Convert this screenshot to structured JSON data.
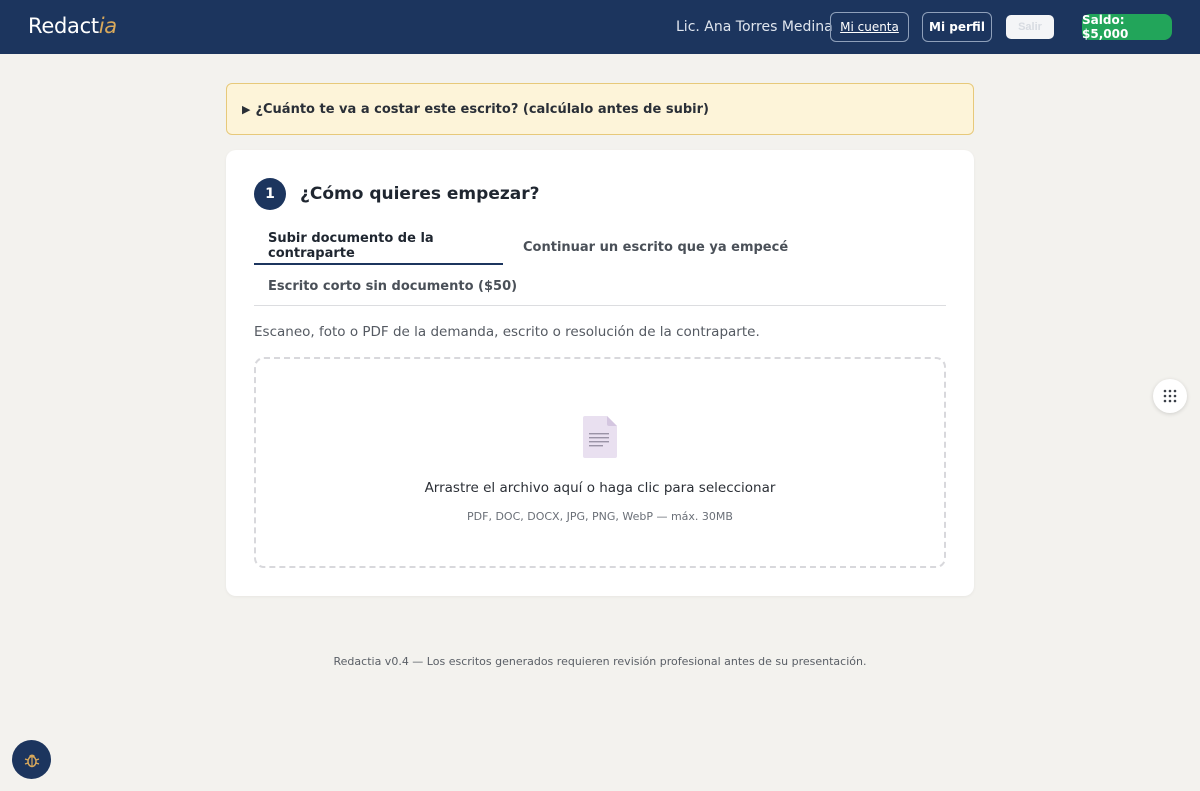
{
  "header": {
    "logo_main": "Redact",
    "logo_accent": "ia",
    "user_name": "Lic. Ana Torres Medina",
    "account_label": "Mi cuenta",
    "profile_label": "Mi perfil",
    "light_button_label": "Salir",
    "balance_label": "Saldo: $5,000"
  },
  "cost_banner": {
    "icon": "triangle-right-icon",
    "text": "¿Cuánto te va a costar este escrito? (calcúlalo antes de subir)"
  },
  "step": {
    "number": "1",
    "title": "¿Cómo quieres empezar?",
    "tabs": [
      {
        "label": "Subir documento de la contraparte",
        "active": true
      },
      {
        "label": "Continuar un escrito que ya empecé",
        "active": false
      },
      {
        "label": "Escrito corto sin documento ($50)",
        "active": false
      }
    ],
    "description": "Escaneo, foto o PDF de la demanda, escrito o resolución de la contraparte.",
    "dropzone": {
      "icon": "document-icon",
      "text": "Arrastre el archivo aquí o haga clic para seleccionar",
      "hint": "PDF, DOC, DOCX, JPG, PNG, WebP — máx. 30MB"
    }
  },
  "footer": {
    "text": "Redactia v0.4 — Los escritos generados requieren revisión profesional antes de su presentación."
  },
  "floating": {
    "grid_icon": "dots-grid-icon",
    "bug_icon": "bug-icon"
  },
  "colors": {
    "header_bg": "#1c355e",
    "accent_gold": "#d9a95b",
    "balance_green": "#22a55a",
    "banner_bg": "#fdf4d9",
    "page_bg": "#f3f2ee"
  }
}
